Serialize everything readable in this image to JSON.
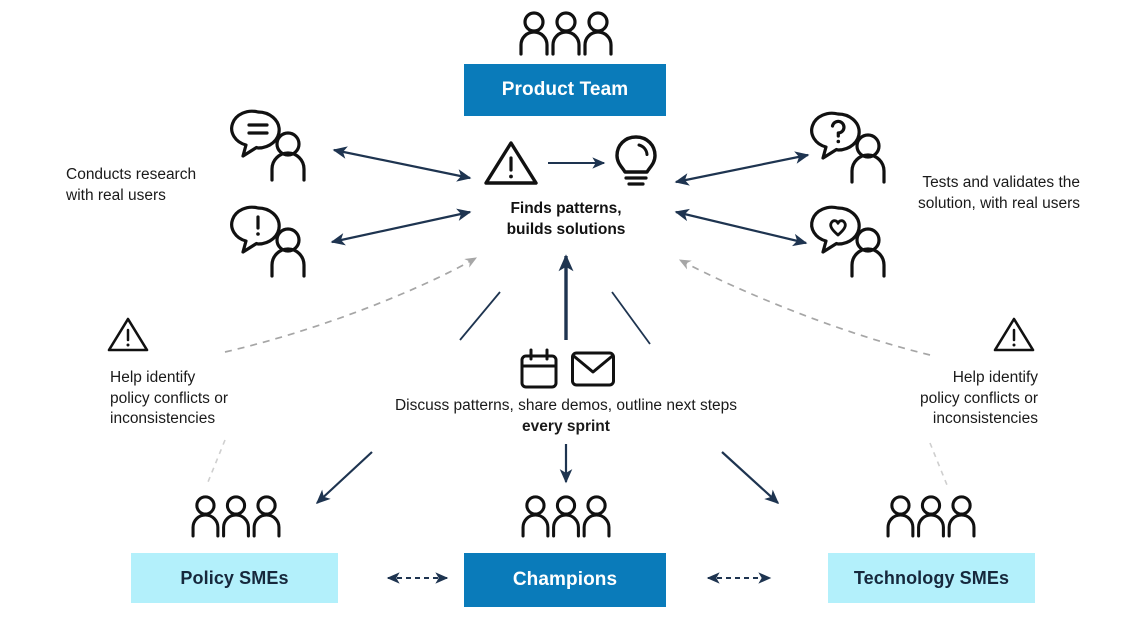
{
  "diagram": {
    "title_nodes": {
      "product_team": "Product Team",
      "policy_smes": "Policy SMEs",
      "champions": "Champions",
      "technology_smes": "Technology SMEs"
    },
    "center": {
      "label_line1": "Finds patterns,",
      "label_line2": "builds solutions",
      "warning_icon": "warning-triangle-icon",
      "idea_icon": "lightbulb-icon"
    },
    "left_branch": {
      "caption_line1": "Conducts research",
      "caption_line2": "with real users",
      "icon_top": "person-chat-lines-icon",
      "icon_bottom": "person-chat-exclamation-icon"
    },
    "right_branch": {
      "caption_line1": "Tests and validates the",
      "caption_line2": "solution, with real users",
      "icon_top": "person-chat-question-icon",
      "icon_bottom": "person-chat-heart-icon"
    },
    "left_sme_note": {
      "line1": "Help identify",
      "line2": "policy conflicts or",
      "line3": "inconsistencies",
      "icon": "warning-triangle-icon"
    },
    "right_sme_note": {
      "line1": "Help identify",
      "line2": "policy conflicts or",
      "line3": "inconsistencies",
      "icon": "warning-triangle-icon"
    },
    "cadence": {
      "text": "Discuss patterns, share demos, outline next steps",
      "emphasis": "every sprint",
      "icon_calendar": "calendar-icon",
      "icon_mail": "envelope-icon"
    },
    "colors": {
      "primary_blue": "#0a7bba",
      "light_blue": "#b3f0fb",
      "arrow_navy": "#1e3450",
      "dashed_grey": "#a6a6a6",
      "icon_black": "#111111",
      "text_dark": "#1a1a1a",
      "box_light_text": "#16283c"
    }
  }
}
